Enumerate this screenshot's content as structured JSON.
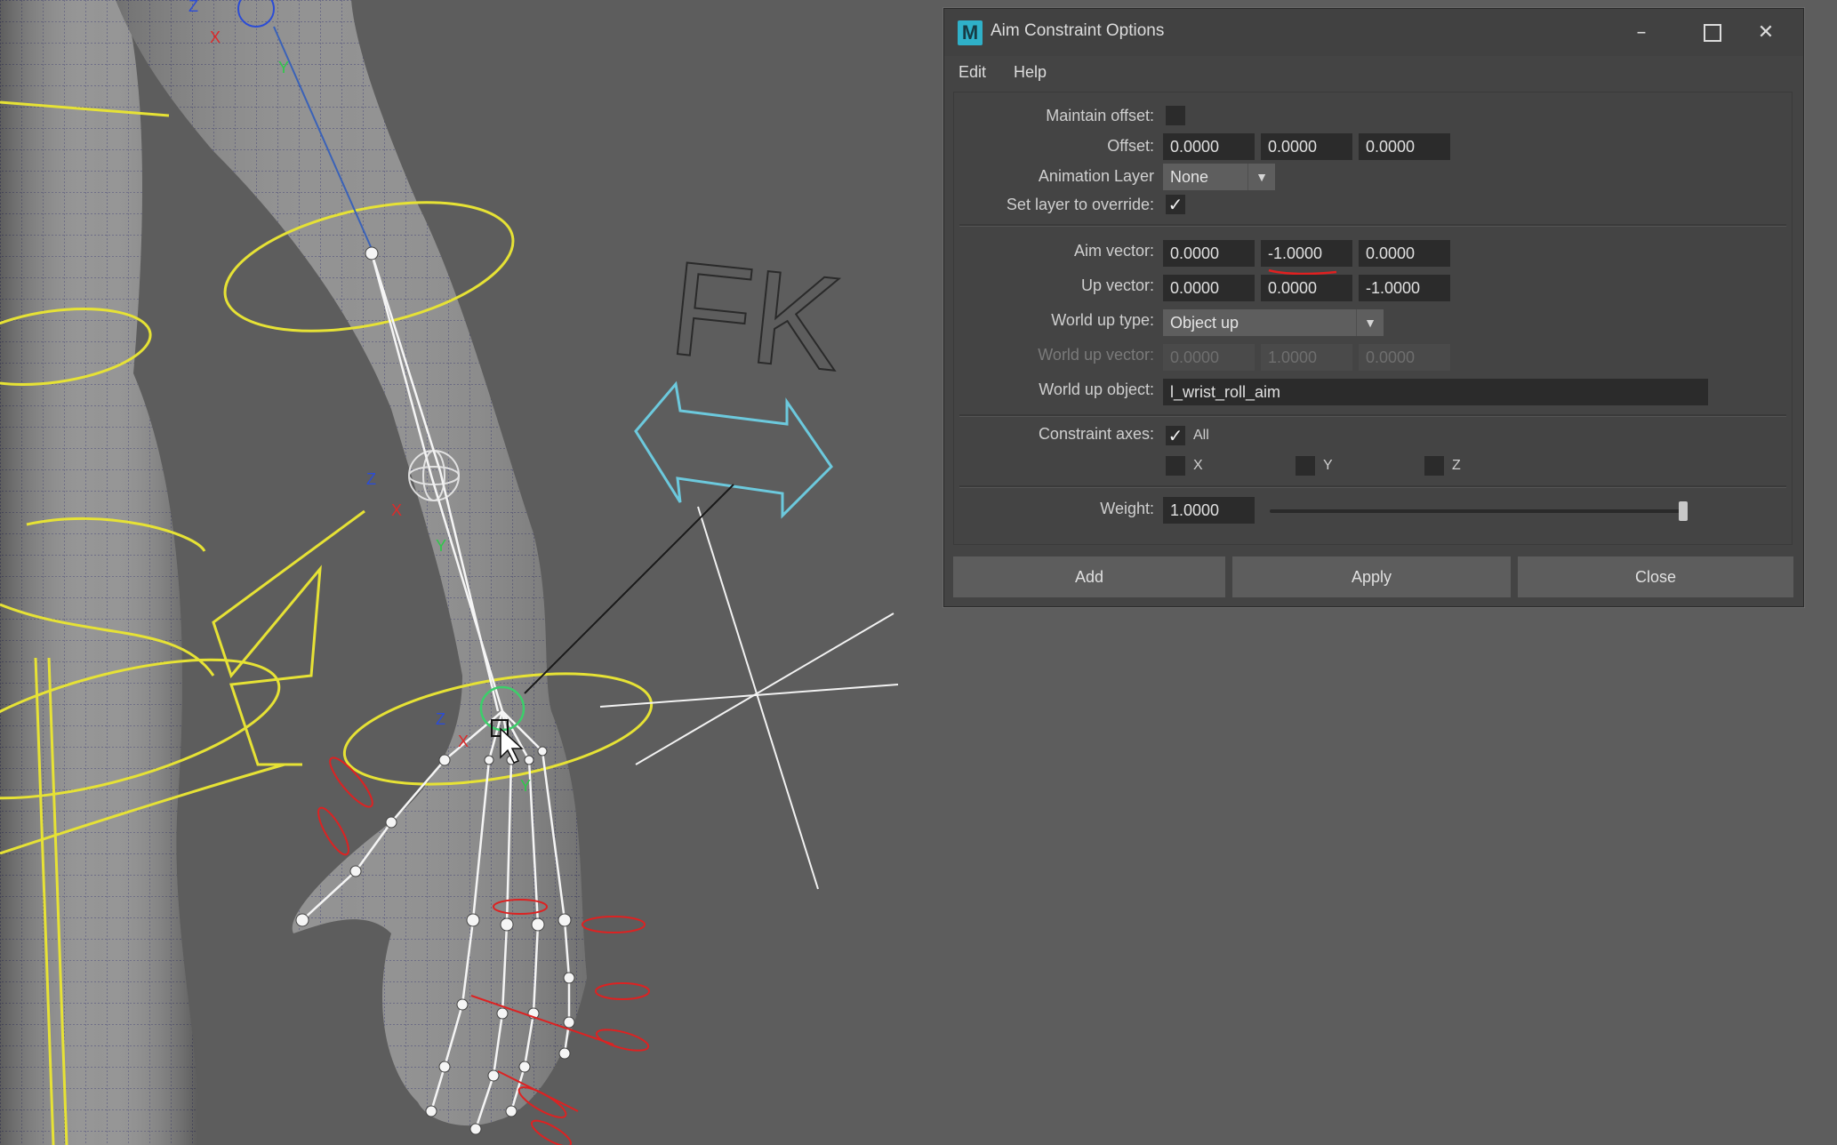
{
  "viewport": {
    "fk_label": "FK",
    "colors": {
      "background": "#5d5d5d",
      "skin": "#8e8e8e",
      "controls_yellow": "#e6e235",
      "arrows_cyan": "#6cc9dd",
      "finger_controls_red": "#dd2222",
      "axis_x": "#dd2a2a",
      "axis_y": "#2ec94a",
      "axis_z": "#2b4cd6"
    },
    "axis_labels": {
      "x": "X",
      "y": "Y",
      "z": "Z"
    }
  },
  "dialog": {
    "title": "Aim Constraint Options",
    "app_icon": "M",
    "window_buttons": {
      "minimize_icon": "minimize-icon",
      "maximize_icon": "maximize-icon",
      "close_icon": "close-icon"
    },
    "menu": [
      "Edit",
      "Help"
    ],
    "maintain_offset": {
      "label": "Maintain offset:",
      "checked": false
    },
    "offset": {
      "label": "Offset:",
      "values": [
        "0.0000",
        "0.0000",
        "0.0000"
      ]
    },
    "animation_layer": {
      "label": "Animation Layer",
      "value": "None"
    },
    "set_layer_override": {
      "label": "Set layer to override:",
      "checked": true
    },
    "aim_vector": {
      "label": "Aim vector:",
      "values": [
        "0.0000",
        "-1.0000",
        "0.0000"
      ]
    },
    "up_vector": {
      "label": "Up vector:",
      "values": [
        "0.0000",
        "0.0000",
        "-1.0000"
      ]
    },
    "world_up_type": {
      "label": "World up type:",
      "value": "Object up"
    },
    "world_up_vector": {
      "label": "World up vector:",
      "values": [
        "0.0000",
        "1.0000",
        "0.0000"
      ],
      "enabled": false
    },
    "world_up_object": {
      "label": "World up object:",
      "value": "l_wrist_roll_aim"
    },
    "constraint_axes": {
      "label": "Constraint axes:",
      "all": {
        "label": "All",
        "checked": true
      },
      "x": {
        "label": "X",
        "checked": false
      },
      "y": {
        "label": "Y",
        "checked": false
      },
      "z": {
        "label": "Z",
        "checked": false
      }
    },
    "weight": {
      "label": "Weight:",
      "value": "1.0000",
      "slider_fraction": 1.0
    },
    "buttons": {
      "add": "Add",
      "apply": "Apply",
      "close": "Close"
    },
    "annotation_color": "#e02020"
  }
}
